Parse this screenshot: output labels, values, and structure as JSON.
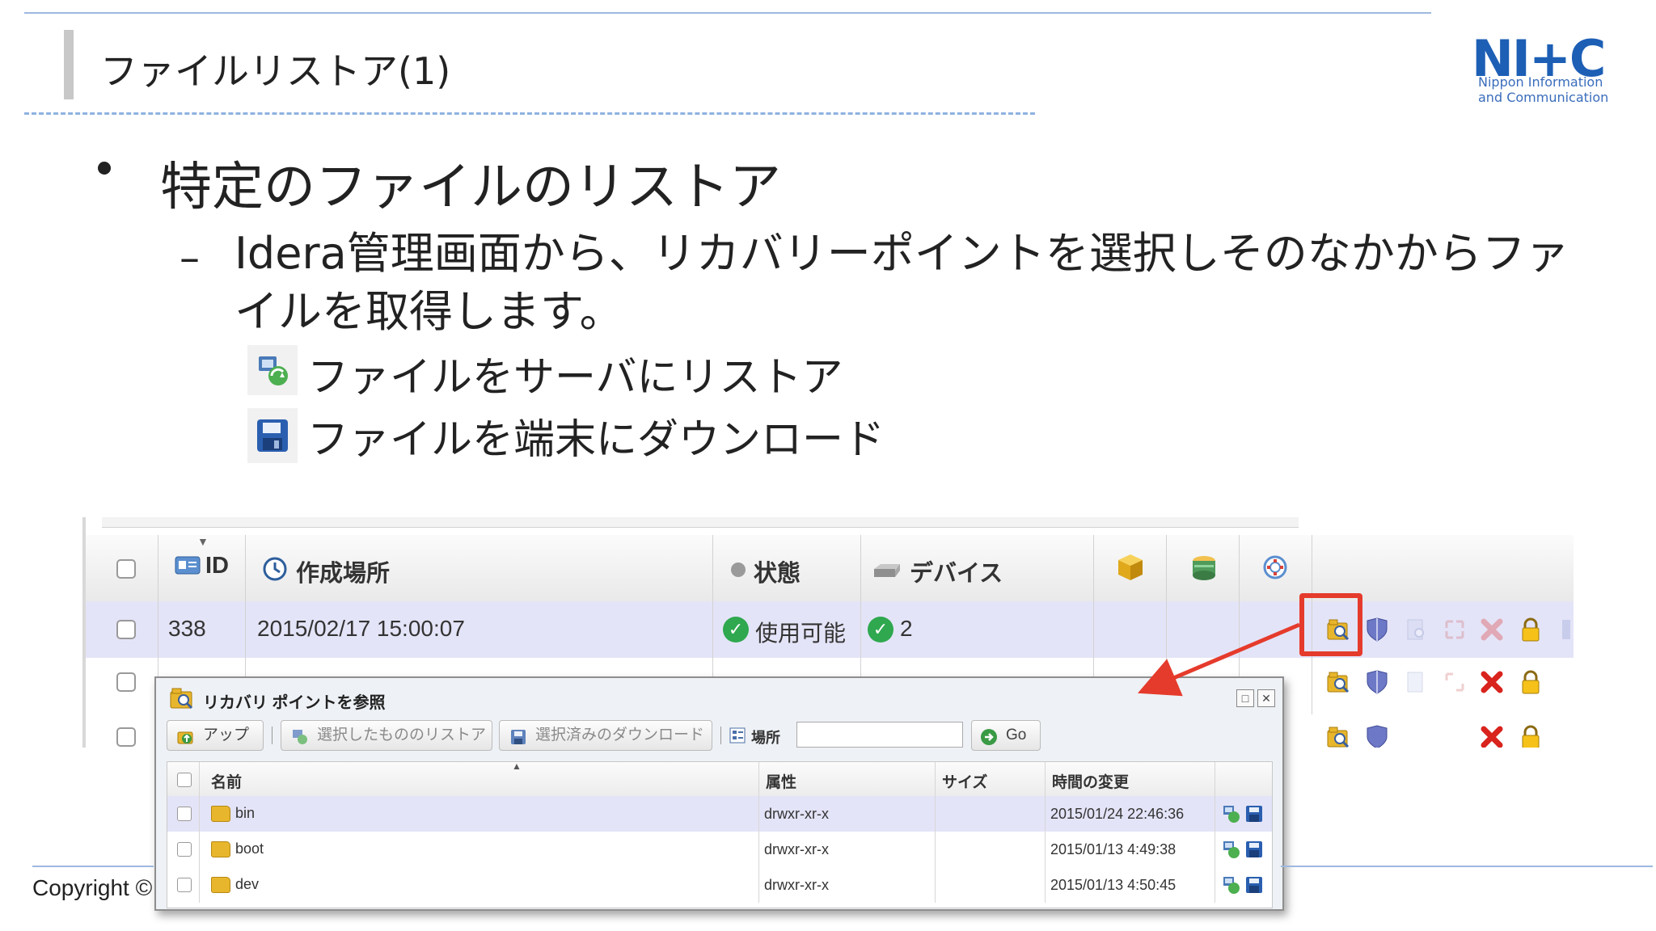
{
  "slide": {
    "title": "ファイルリストア(1)",
    "bullet1": "特定のファイルのリストア",
    "bullet2": "Idera管理画面から、リカバリーポイントを選択しそのなかからファイルを取得します。",
    "bullet3": "ファイルをサーバにリストア",
    "bullet4": "ファイルを端末にダウンロード",
    "copyright": "Copyright ©"
  },
  "logo": {
    "mark": "NI+C",
    "line1": "Nippon Information",
    "line2": "and Communication"
  },
  "grid": {
    "headers": {
      "id": "ID",
      "created": "作成場所",
      "state": "状態",
      "device": "デバイス"
    },
    "rows": [
      {
        "id": "338",
        "created": "2015/02/17 15:00:07",
        "state": "使用可能",
        "device": "2"
      }
    ]
  },
  "dialog": {
    "title": "リカバリ ポイントを参照",
    "toolbar": {
      "up": "アップ",
      "restore_selected": "選択したもののリストア",
      "download_selected": "選択済みのダウンロード",
      "location_label": "場所",
      "location_value": "",
      "go": "Go"
    },
    "columns": {
      "name": "名前",
      "attr": "属性",
      "size": "サイズ",
      "mtime": "時間の変更"
    },
    "rows": [
      {
        "name": "bin",
        "attr": "drwxr-xr-x",
        "size": "",
        "mtime": "2015/01/24 22:46:36"
      },
      {
        "name": "boot",
        "attr": "drwxr-xr-x",
        "size": "",
        "mtime": "2015/01/13 4:49:38"
      },
      {
        "name": "dev",
        "attr": "drwxr-xr-x",
        "size": "",
        "mtime": "2015/01/13 4:50:45"
      }
    ]
  },
  "colors": {
    "accent_blue": "#1d5fb5",
    "highlight_red": "#e53b2c",
    "selected_row": "#e4e4f8",
    "ok_green": "#2fa84f"
  }
}
